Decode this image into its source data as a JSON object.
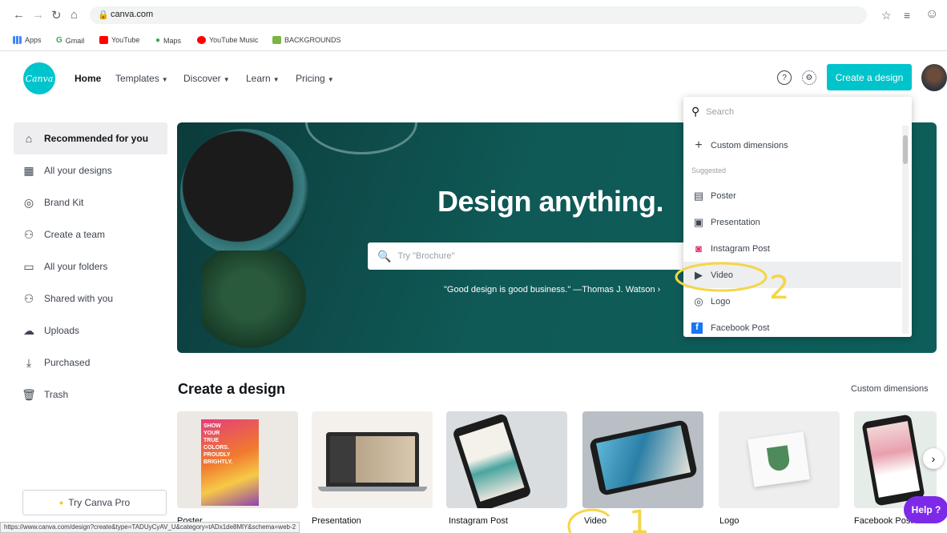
{
  "browser": {
    "url": "canva.com",
    "status_url": "https://www.canva.com/design?create&type=TADUyCyAV_U&category=tADx1de8MlY&schema=web-2",
    "bookmarks": [
      "Apps",
      "Gmail",
      "YouTube",
      "Maps",
      "YouTube Music",
      "BACKGROUNDS"
    ]
  },
  "header": {
    "logo": "Canva",
    "nav": [
      "Home",
      "Templates",
      "Discover",
      "Learn",
      "Pricing"
    ],
    "create_button": "Create a design"
  },
  "sidebar": {
    "items": [
      {
        "label": "Recommended for you",
        "icon": "home-icon"
      },
      {
        "label": "All your designs",
        "icon": "grid-icon"
      },
      {
        "label": "Brand Kit",
        "icon": "brand-kit-icon"
      },
      {
        "label": "Create a team",
        "icon": "team-icon"
      },
      {
        "label": "All your folders",
        "icon": "folder-icon"
      },
      {
        "label": "Shared with you",
        "icon": "shared-icon"
      },
      {
        "label": "Uploads",
        "icon": "upload-icon"
      },
      {
        "label": "Purchased",
        "icon": "download-icon"
      },
      {
        "label": "Trash",
        "icon": "trash-icon"
      }
    ],
    "try_pro": "Try Canva Pro"
  },
  "hero": {
    "title": "Design anything.",
    "search_placeholder": "Try \"Brochure\"",
    "quote": "\"Good design is good business.\" —Thomas J. Watson ›"
  },
  "dropdown": {
    "search_placeholder": "Search",
    "custom": "Custom dimensions",
    "section": "Suggested",
    "items": [
      "Poster",
      "Presentation",
      "Instagram Post",
      "Video",
      "Logo",
      "Facebook Post"
    ]
  },
  "create_section": {
    "title": "Create a design",
    "link": "Custom dimensions",
    "cards": [
      "Poster",
      "Presentation",
      "Instagram Post",
      "Video",
      "Logo",
      "Facebook Post"
    ],
    "poster_art": [
      "SHOW",
      "YOUR",
      "TRUE",
      "COLORS.",
      "PROUDLY",
      "BRIGHTLY."
    ]
  },
  "help": "Help ?",
  "annotations": [
    "1",
    "2"
  ],
  "colors": {
    "accent": "#00c4cc",
    "help": "#7d2ae8",
    "hero": "#0f5a57",
    "annotation": "#f5d547"
  }
}
